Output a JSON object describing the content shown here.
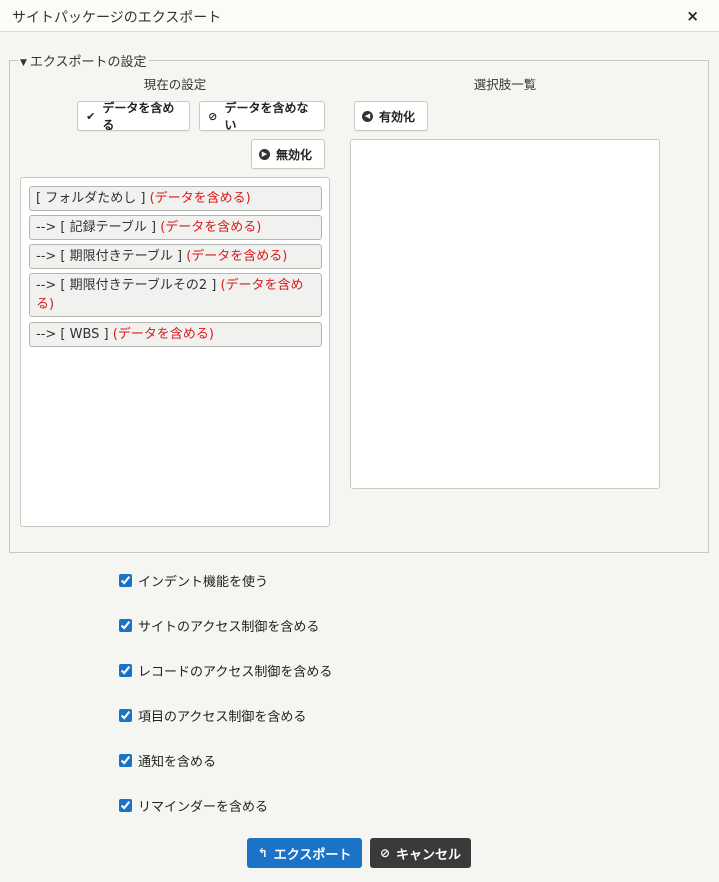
{
  "dialog": {
    "title": "サイトパッケージのエクスポート",
    "close_icon": "×"
  },
  "export_settings": {
    "legend": "エクスポートの設定",
    "current": {
      "header": "現在の設定",
      "include_data_button": "データを含める",
      "exclude_data_button": "データを含めない",
      "disable_button": "無効化",
      "items": [
        {
          "label": "[ フォルダためし ]",
          "note": "(データを含める)"
        },
        {
          "label": "--> [ 記録テーブル ]",
          "note": "(データを含める)"
        },
        {
          "label": "--> [ 期限付きテーブル ]",
          "note": "(データを含める)"
        },
        {
          "label": "--> [ 期限付きテーブルその2 ]",
          "note": "(データを含める)"
        },
        {
          "label": "--> [ WBS ]",
          "note": "(データを含める)"
        }
      ]
    },
    "options": {
      "header": "選択肢一覧",
      "enable_button": "有効化",
      "items": []
    }
  },
  "checkboxes": [
    {
      "label": "インデント機能を使う",
      "checked": true
    },
    {
      "label": "サイトのアクセス制御を含める",
      "checked": true
    },
    {
      "label": "レコードのアクセス制御を含める",
      "checked": true
    },
    {
      "label": "項目のアクセス制御を含める",
      "checked": true
    },
    {
      "label": "通知を含める",
      "checked": true
    },
    {
      "label": "リマインダーを含める",
      "checked": true
    }
  ],
  "actions": {
    "export_label": "エクスポート",
    "cancel_label": "キャンセル"
  },
  "colors": {
    "primary": "#1a73c7",
    "dark": "#3a3a3a",
    "note_red": "#d61c1c"
  }
}
